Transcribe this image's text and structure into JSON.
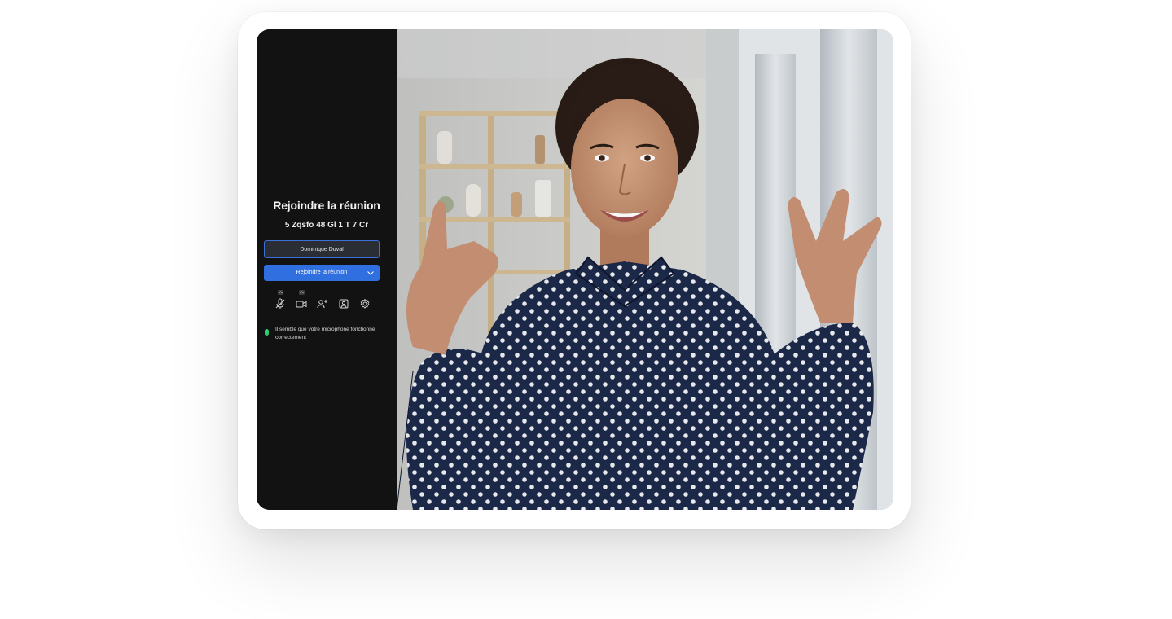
{
  "join_panel": {
    "title": "Rejoindre la réunion",
    "meeting_id": "5 Zqsfo 48 Gl 1 T 7 Cr",
    "name_input_value": "Dominique Duval",
    "join_button_label": "Rejoindre la réunion",
    "controls": [
      {
        "icon": "microphone-off-icon",
        "has_options": true
      },
      {
        "icon": "video-camera-icon",
        "has_options": true
      },
      {
        "icon": "add-person-icon",
        "has_options": false
      },
      {
        "icon": "background-image-icon",
        "has_options": false
      },
      {
        "icon": "settings-gear-icon",
        "has_options": false
      }
    ],
    "status_message": "Il semble que votre microphone fonctionne correctement",
    "status_color": "#2ecc71"
  },
  "colors": {
    "panel_bg": "#121212",
    "accent_blue": "#2f6fe0",
    "input_border": "#3b6fd9",
    "shirt_navy": "#1d2a4a"
  }
}
